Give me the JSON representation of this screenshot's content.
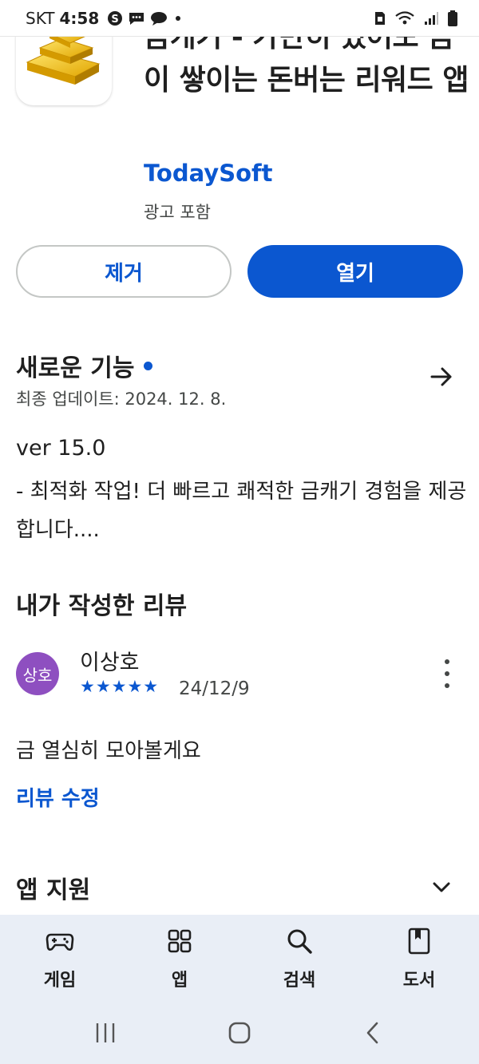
{
  "status_bar": {
    "carrier": "SKT",
    "time": "4:58"
  },
  "app": {
    "title": "금캐기 - 가만히 있어도 금이 쌓이는 돈버는 리워드 앱",
    "developer": "TodaySoft",
    "ads_note": "광고 포함",
    "remove_label": "제거",
    "open_label": "열기"
  },
  "whats_new": {
    "title": "새로운 기능",
    "updated": "최종 업데이트: 2024. 12. 8.",
    "version": "ver 15.0",
    "notes": "- 최적화 작업! 더 빠르고 쾌적한 금캐기 경험을 제공합니다...."
  },
  "my_review": {
    "title": "내가 작성한 리뷰",
    "avatar_text": "상호",
    "reviewer": "이상호",
    "rating": 5,
    "stars": "★★★★★",
    "date": "24/12/9",
    "text": "금 열심히 모아볼게요",
    "edit_label": "리뷰 수정"
  },
  "app_support": {
    "title": "앱 지원"
  },
  "bottom_nav": {
    "items": [
      {
        "label": "게임",
        "icon": "gamepad-icon"
      },
      {
        "label": "앱",
        "icon": "apps-grid-icon"
      },
      {
        "label": "검색",
        "icon": "search-icon"
      },
      {
        "label": "도서",
        "icon": "book-icon"
      }
    ]
  },
  "colors": {
    "accent": "#0b57d0",
    "avatar": "#8e4fc0",
    "nav_background": "#e9eef6"
  }
}
